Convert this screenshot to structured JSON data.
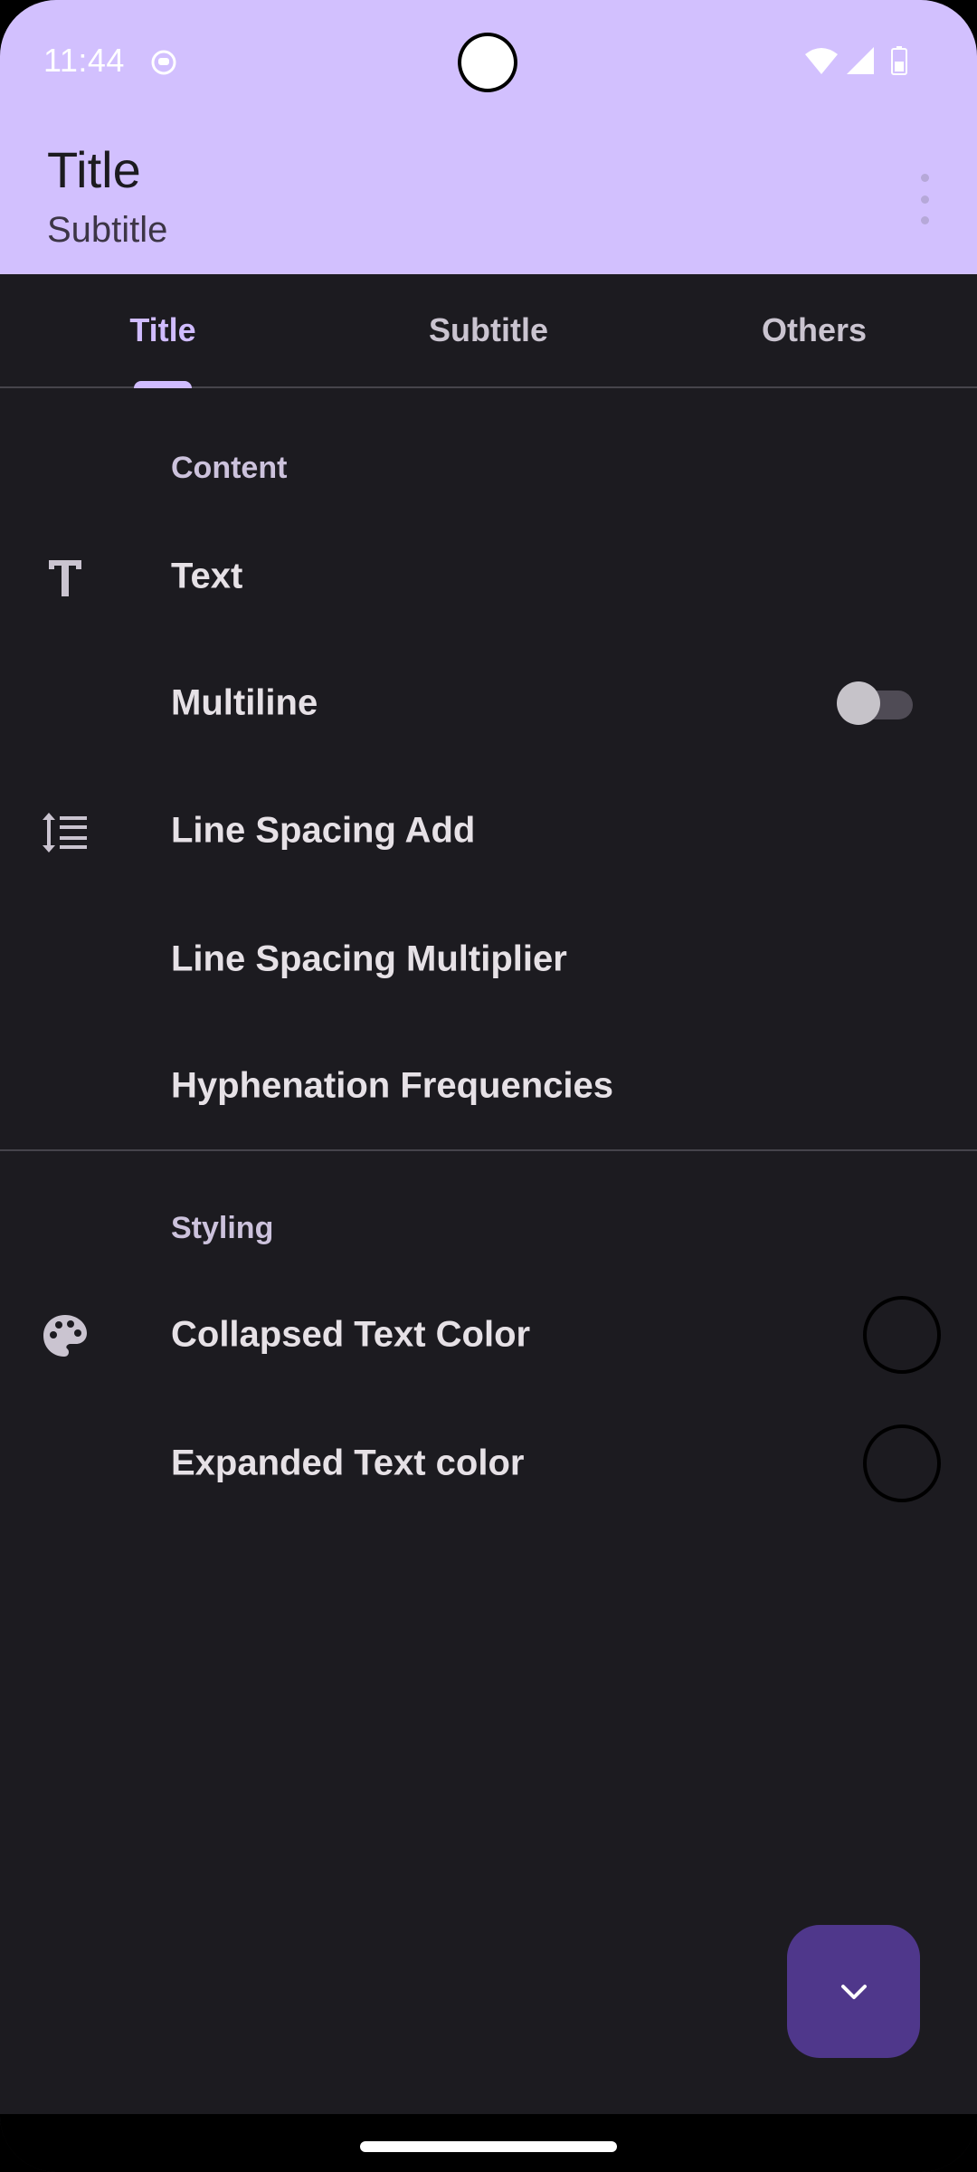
{
  "status_bar": {
    "time": "11:44"
  },
  "app_bar": {
    "title": "Title",
    "subtitle": "Subtitle"
  },
  "tabs": [
    {
      "label": "Title",
      "selected": true
    },
    {
      "label": "Subtitle",
      "selected": false
    },
    {
      "label": "Others",
      "selected": false
    }
  ],
  "sections": {
    "content": {
      "header": "Content",
      "items": {
        "text": {
          "label": "Text",
          "icon": "text-format-icon"
        },
        "multiline": {
          "label": "Multiline",
          "switch_on": false
        },
        "line_spacing_add": {
          "label": "Line Spacing Add",
          "icon": "line-spacing-icon"
        },
        "line_spacing_multiplier": {
          "label": "Line Spacing Multiplier"
        },
        "hyphenation": {
          "label": "Hyphenation Frequencies"
        }
      }
    },
    "styling": {
      "header": "Styling",
      "items": {
        "collapsed_color": {
          "label": "Collapsed Text Color",
          "icon": "palette-icon",
          "color": "#000000"
        },
        "expanded_color": {
          "label": "Expanded Text color",
          "color": "#000000"
        }
      }
    }
  },
  "fab": {
    "icon": "chevron-down-icon"
  },
  "colors": {
    "header_bg": "#d2c0fe",
    "background": "#1c1b20",
    "accent": "#d0bcff",
    "fab_bg": "#4f378b"
  }
}
